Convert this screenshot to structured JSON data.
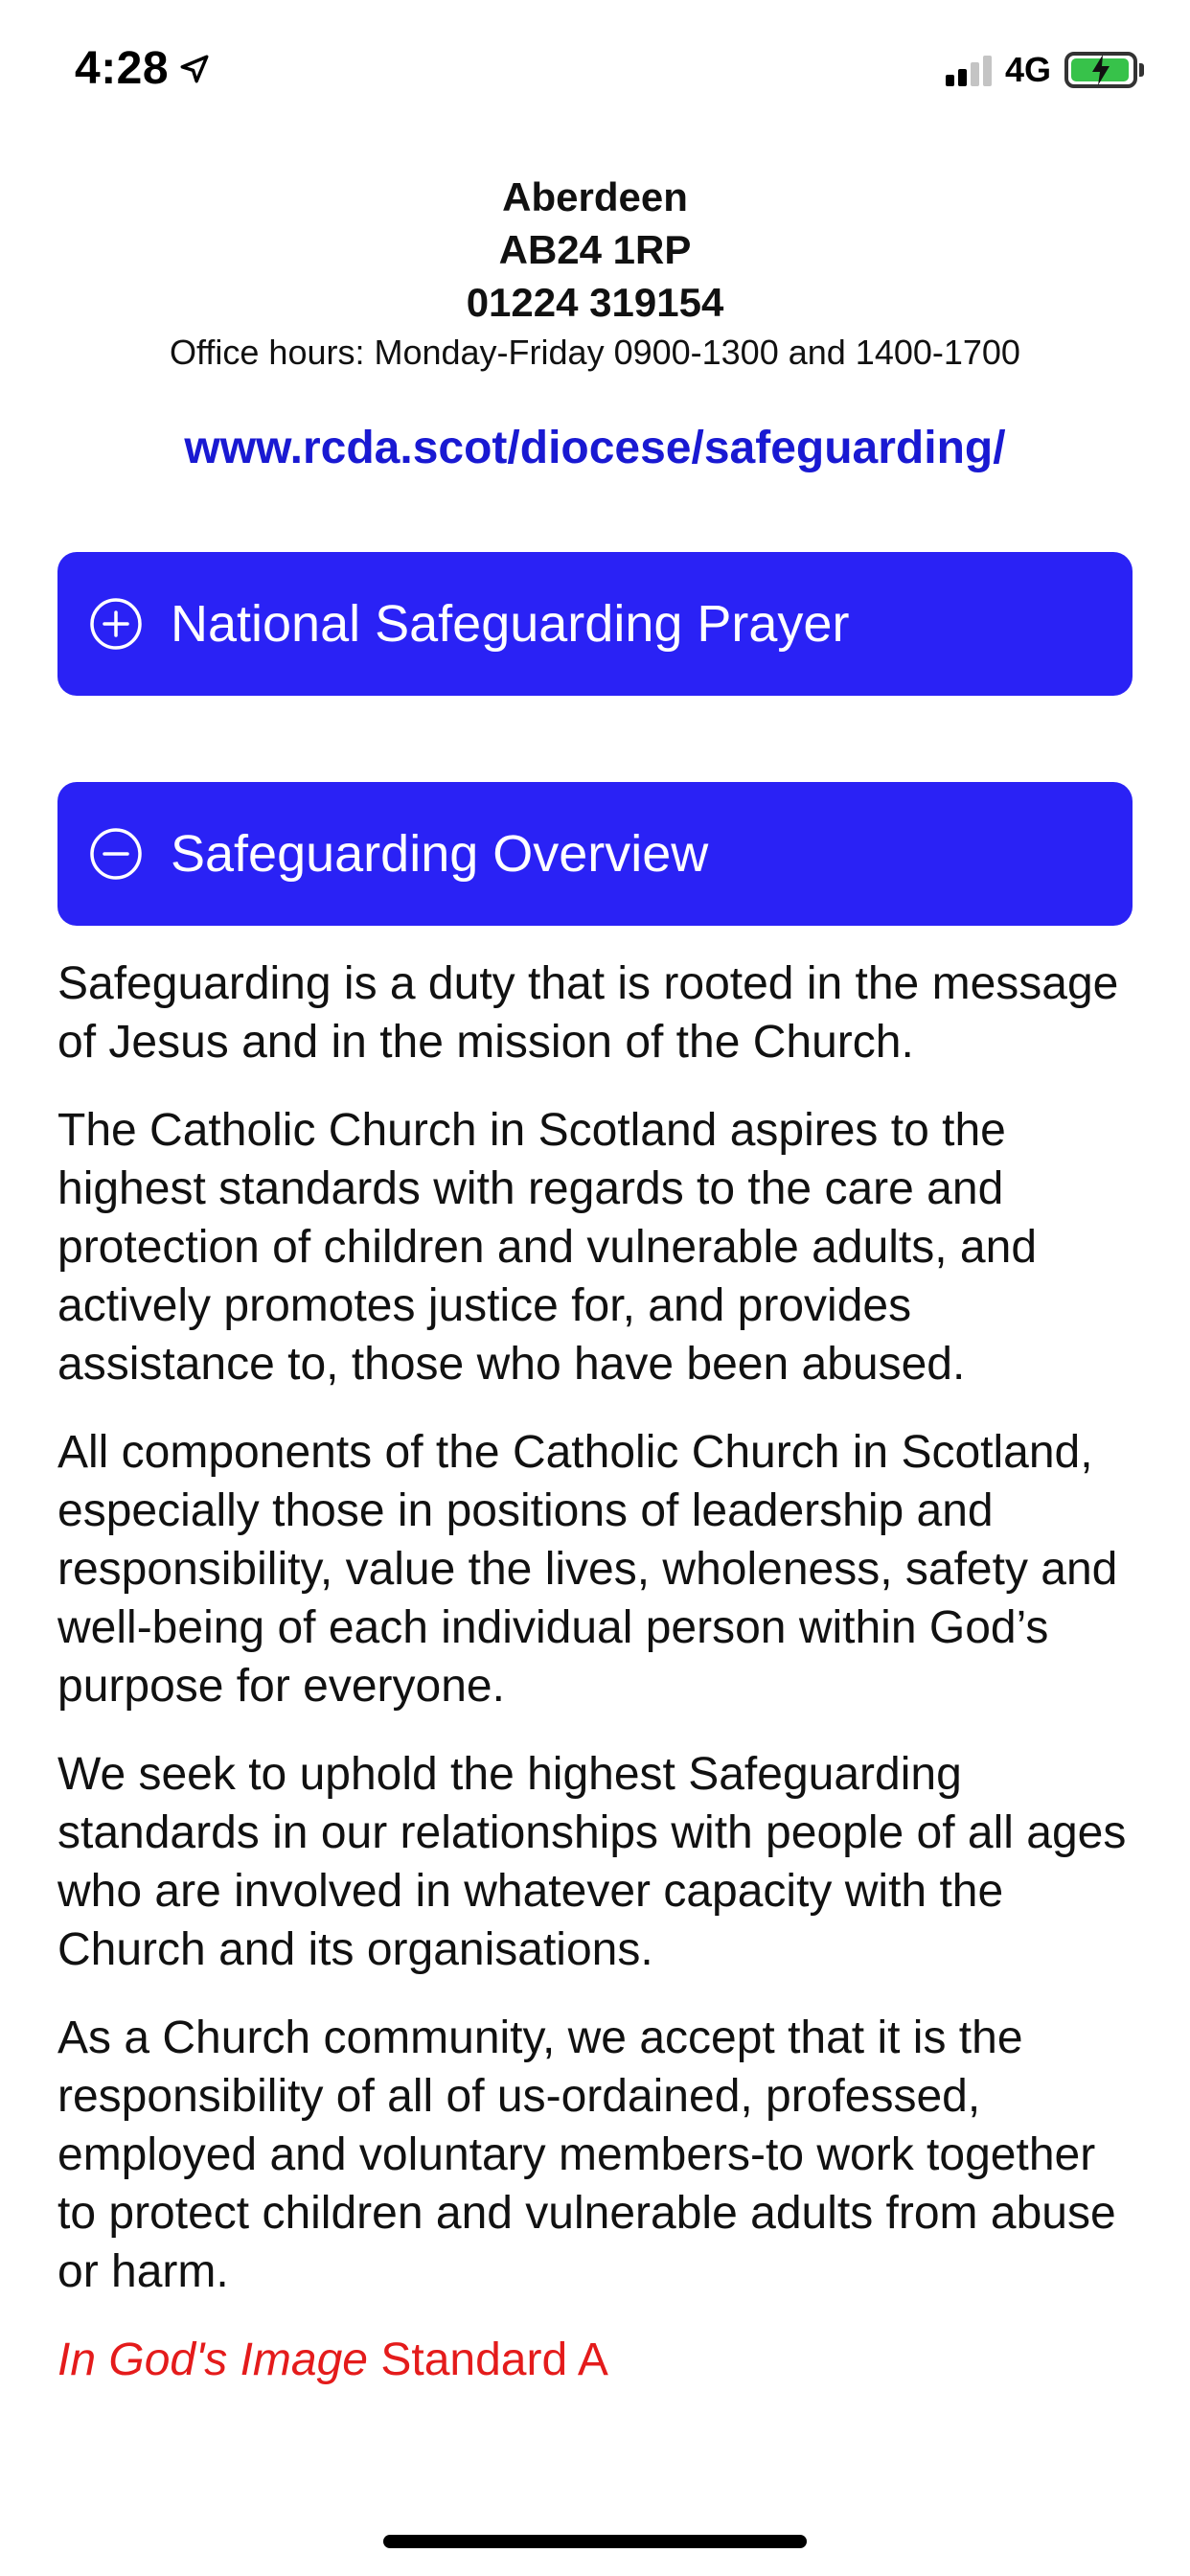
{
  "status_bar": {
    "time": "4:28",
    "network": "4G",
    "location_icon": "location-arrow-icon",
    "signal_icon": "cellular-signal-icon",
    "battery_icon": "battery-charging-icon",
    "battery_color": "#37c24a"
  },
  "contact": {
    "city": "Aberdeen",
    "postcode": "AB24 1RP",
    "phone": "01224 319154",
    "office_hours": "Office hours: Monday-Friday 0900-1300 and 1400-1700",
    "website": "www.rcda.scot/diocese/safeguarding/",
    "link_color": "#1919d2"
  },
  "accordions": [
    {
      "label": "National Safeguarding Prayer",
      "icon": "plus-circle-icon",
      "expanded": false
    },
    {
      "label": "Safeguarding Overview",
      "icon": "minus-circle-icon",
      "expanded": true
    }
  ],
  "accent_color": "#2a22f5",
  "overview": {
    "paragraphs": [
      "Safeguarding is a duty that is rooted in the message of Jesus and in the mission of the Church.",
      "The Catholic Church in Scotland aspires to the highest standards with regards to the care and protection of children and vulnerable adults, and actively promotes justice for, and provides assistance to, those who have been abused.",
      "All components of the Catholic Church in Scotland, especially those in positions of leadership and responsibility, value the lives, wholeness, safety and well-being of each individual person within God’s purpose for everyone.",
      "We seek to uphold the highest Safeguarding standards in our relationships with people of all ages who are involved in whatever capacity with the Church and its organisations.",
      "As a Church community, we accept that it is the responsibility of all of us-ordained, professed, employed and voluntary members-to work together to protect children and vulnerable adults from abuse or harm."
    ],
    "standard_italic": "In God's Image",
    "standard_rest": " Standard A",
    "standard_color": "#e41b1b"
  }
}
